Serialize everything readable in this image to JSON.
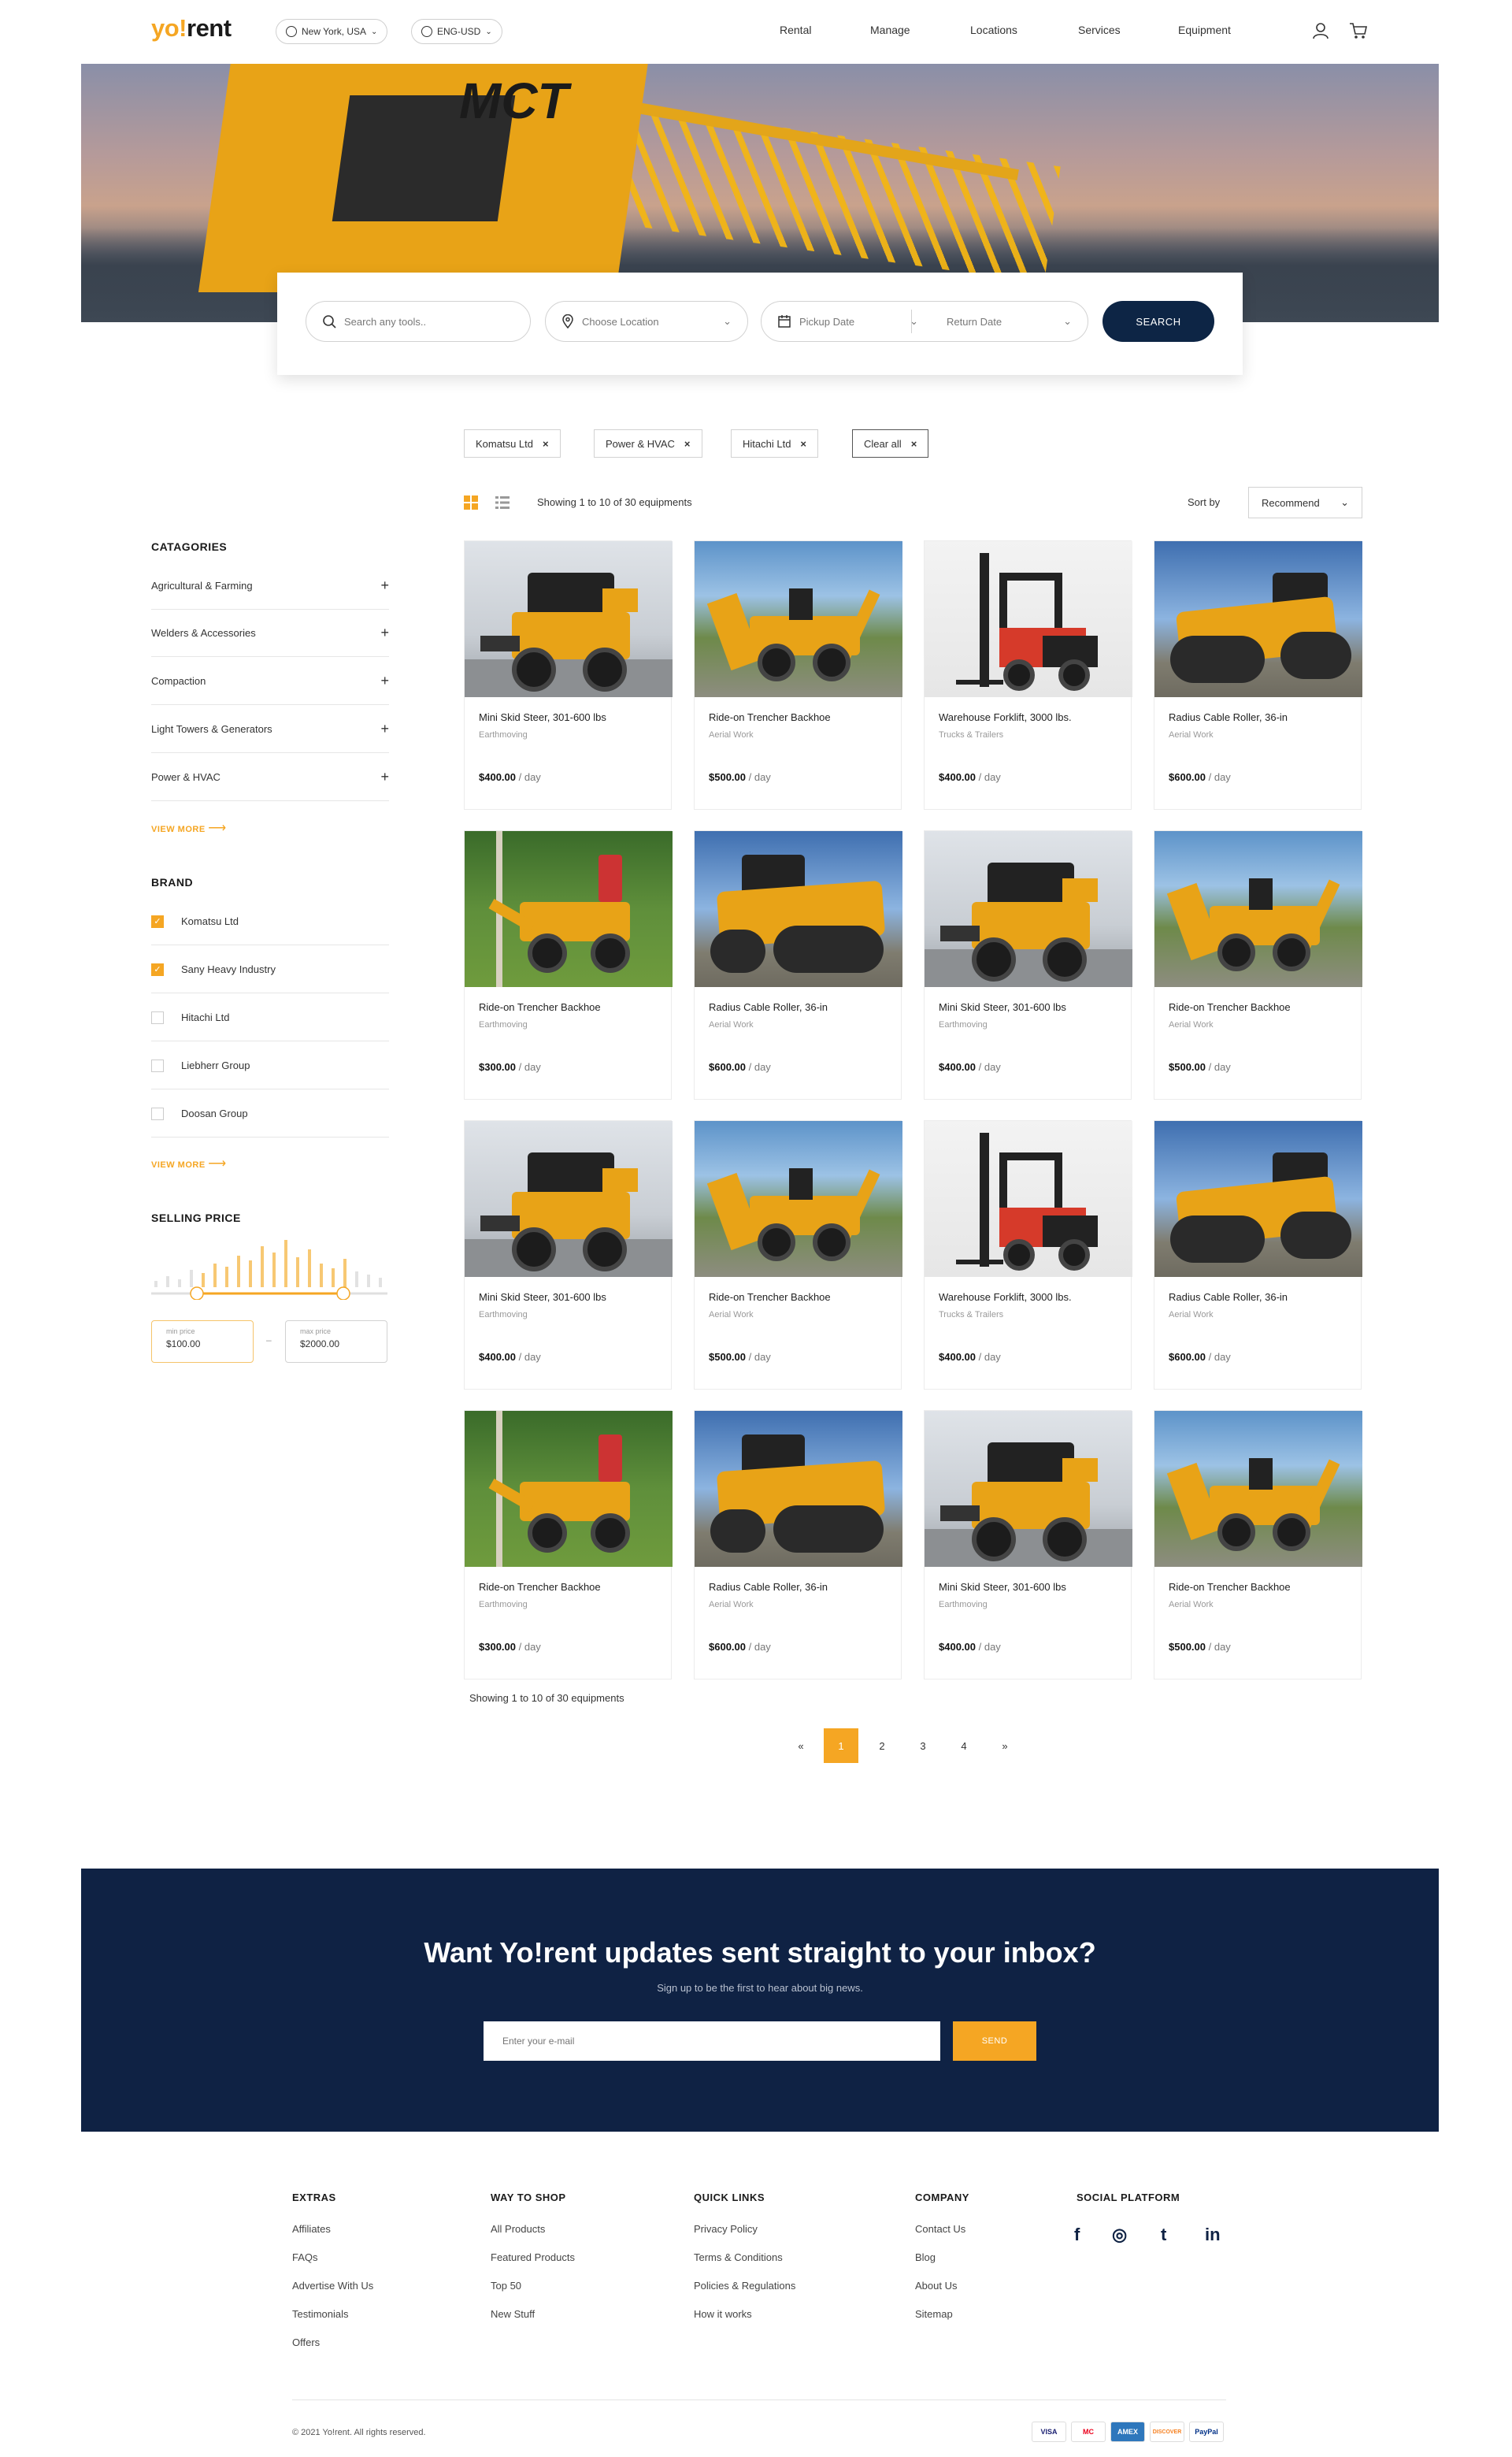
{
  "header": {
    "logo_yo": "yo!",
    "logo_rent": "rent",
    "location": "New York, USA",
    "currency": "ENG-USD",
    "nav": [
      "Rental",
      "Manage",
      "Locations",
      "Services",
      "Equipment"
    ]
  },
  "hero": {
    "crane_label": "MCT"
  },
  "search": {
    "placeholder": "Search any tools..",
    "location": "Choose Location",
    "pickup": "Pickup Date",
    "return": "Return Date",
    "button": "SEARCH"
  },
  "filters": {
    "chips": [
      "Komatsu Ltd",
      "Power & HVAC",
      "Hitachi Ltd"
    ],
    "clear_all": "Clear all"
  },
  "toolbar": {
    "showing": "Showing 1 to 10 of 30 equipments",
    "sort_label": "Sort by",
    "sort_value": "Recommend"
  },
  "sidebar": {
    "categories_title": "CATAGORIES",
    "categories": [
      "Agricultural & Farming",
      "Welders & Accessories",
      "Compaction",
      "Light Towers & Generators",
      "Power & HVAC"
    ],
    "view_more": "VIEW MORE",
    "brand_title": "BRAND",
    "brands": [
      {
        "name": "Komatsu Ltd",
        "checked": true
      },
      {
        "name": "Sany Heavy Industry",
        "checked": true
      },
      {
        "name": "Hitachi Ltd",
        "checked": false
      },
      {
        "name": "Liebherr Group",
        "checked": false
      },
      {
        "name": "Doosan Group",
        "checked": false
      }
    ],
    "price_title": "SELLING PRICE",
    "min_label": "min price",
    "min_value": "$100.00",
    "max_label": "max price",
    "max_value": "$2000.00",
    "range_separator": "–"
  },
  "products": [
    {
      "name": "Mini Skid Steer, 301-600 lbs",
      "category": "Earthmoving",
      "price": "$400.00",
      "unit": "/ day",
      "type": "skid"
    },
    {
      "name": "Ride-on Trencher Backhoe",
      "category": "Aerial Work",
      "price": "$500.00",
      "unit": "/ day",
      "type": "trencher"
    },
    {
      "name": "Warehouse Forklift, 3000 lbs.",
      "category": "Trucks & Trailers",
      "price": "$400.00",
      "unit": "/ day",
      "type": "forklift"
    },
    {
      "name": "Radius Cable Roller, 36-in",
      "category": "Aerial Work",
      "price": "$600.00",
      "unit": "/ day",
      "type": "roller"
    },
    {
      "name": "Ride-on Trencher Backhoe",
      "category": "Earthmoving",
      "price": "$300.00",
      "unit": "/ day",
      "type": "forest"
    },
    {
      "name": "Radius Cable Roller, 36-in",
      "category": "Aerial Work",
      "price": "$600.00",
      "unit": "/ day",
      "type": "roller2"
    },
    {
      "name": "Mini Skid Steer, 301-600 lbs",
      "category": "Earthmoving",
      "price": "$400.00",
      "unit": "/ day",
      "type": "skid"
    },
    {
      "name": "Ride-on Trencher Backhoe",
      "category": "Aerial Work",
      "price": "$500.00",
      "unit": "/ day",
      "type": "trencher"
    },
    {
      "name": "Mini Skid Steer, 301-600 lbs",
      "category": "Earthmoving",
      "price": "$400.00",
      "unit": "/ day",
      "type": "skid"
    },
    {
      "name": "Ride-on Trencher Backhoe",
      "category": "Aerial Work",
      "price": "$500.00",
      "unit": "/ day",
      "type": "trencher"
    },
    {
      "name": "Warehouse Forklift, 3000 lbs.",
      "category": "Trucks & Trailers",
      "price": "$400.00",
      "unit": "/ day",
      "type": "forklift"
    },
    {
      "name": "Radius Cable Roller, 36-in",
      "category": "Aerial Work",
      "price": "$600.00",
      "unit": "/ day",
      "type": "roller"
    },
    {
      "name": "Ride-on Trencher Backhoe",
      "category": "Earthmoving",
      "price": "$300.00",
      "unit": "/ day",
      "type": "forest"
    },
    {
      "name": "Radius Cable Roller, 36-in",
      "category": "Aerial Work",
      "price": "$600.00",
      "unit": "/ day",
      "type": "roller2"
    },
    {
      "name": "Mini Skid Steer, 301-600 lbs",
      "category": "Earthmoving",
      "price": "$400.00",
      "unit": "/ day",
      "type": "skid"
    },
    {
      "name": "Ride-on Trencher Backhoe",
      "category": "Aerial Work",
      "price": "$500.00",
      "unit": "/ day",
      "type": "trencher"
    }
  ],
  "pagination": {
    "prev": "«",
    "pages": [
      "1",
      "2",
      "3",
      "4"
    ],
    "next": "»",
    "current": "1"
  },
  "newsletter": {
    "title": "Want Yo!rent updates sent straight to your inbox?",
    "subtitle": "Sign up to be the first to hear about big news.",
    "placeholder": "Enter your e-mail",
    "button": "SEND"
  },
  "footer": {
    "columns": [
      {
        "title": "EXTRAS",
        "links": [
          "Affiliates",
          "FAQs",
          "Advertise With Us",
          "Testimonials",
          "Offers"
        ]
      },
      {
        "title": "WAY TO SHOP",
        "links": [
          "All Products",
          "Featured Products",
          "Top 50",
          "New Stuff"
        ]
      },
      {
        "title": "QUICK LINKS",
        "links": [
          "Privacy Policy",
          "Terms & Conditions",
          "Policies & Regulations",
          "How it works"
        ]
      },
      {
        "title": "COMPANY",
        "links": [
          "Contact Us",
          "Blog",
          "About Us",
          "Sitemap"
        ]
      }
    ],
    "social_title": "SOCIAL PLATFORM",
    "social": [
      "f",
      "◎",
      "t",
      "in"
    ],
    "copyright": "© 2021 Yo!rent. All rights reserved.",
    "payments": [
      "VISA",
      "MC",
      "AMEX",
      "DISCOVER",
      "PayPal"
    ],
    "colors": {
      "accent": "#f5a623",
      "navy": "#0f2244"
    }
  }
}
